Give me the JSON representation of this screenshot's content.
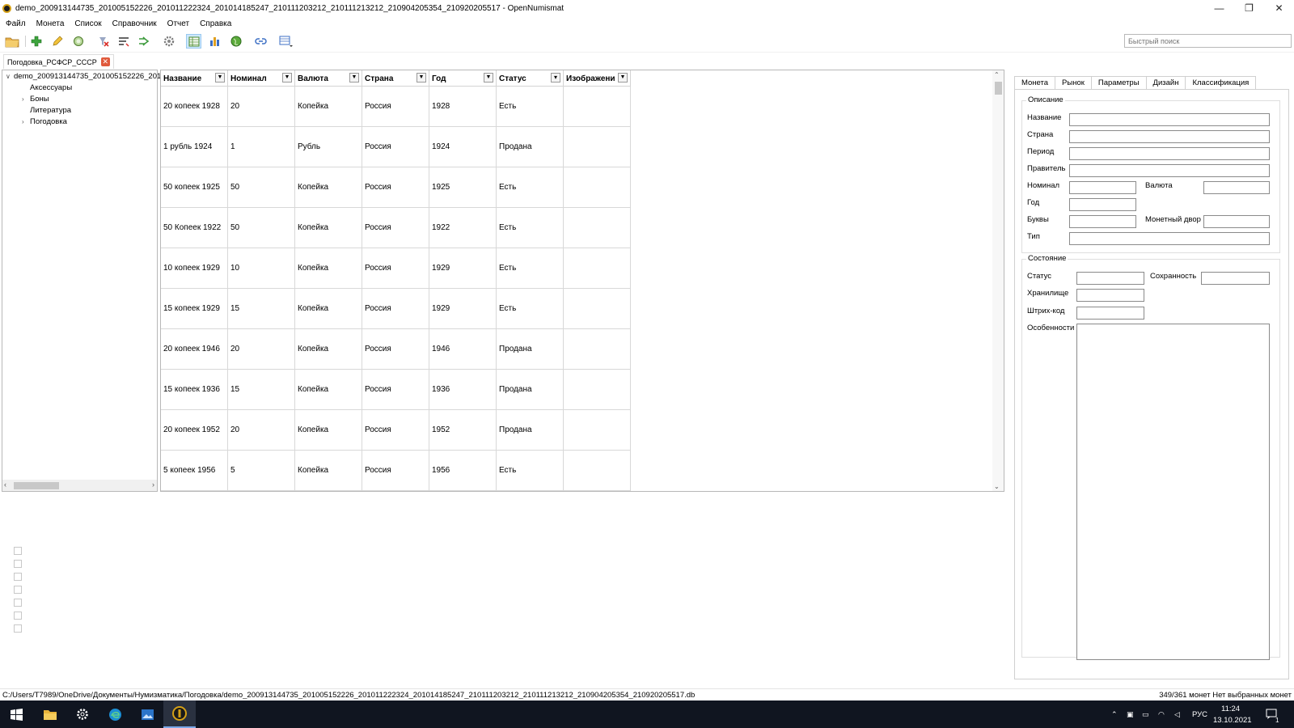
{
  "window": {
    "title": "demo_200913144735_201005152226_201011222324_201014185247_210111203212_210111213212_210904205354_210920205517 - OpenNumismat",
    "minimize": "—",
    "restore": "❐",
    "close": "✕"
  },
  "menu": [
    "Файл",
    "Монета",
    "Список",
    "Справочник",
    "Отчет",
    "Справка"
  ],
  "toolbar": {
    "icons": [
      "open-folder-icon",
      "add-icon",
      "edit-icon",
      "clone-icon",
      "delete-icon",
      "sort-icon",
      "merge-icon",
      "settings-gear-icon",
      "list-view-icon",
      "statistics-icon",
      "globe-icon",
      "link-icon",
      "table-settings-icon"
    ],
    "search_placeholder": "Быстрый поиск"
  },
  "doc_tab": {
    "label": "Погодовка_РСФСР_СССР",
    "close": "✕"
  },
  "tree": {
    "root": "demo_200913144735_201005152226_201",
    "items": [
      {
        "label": "Аксессуары",
        "expandable": false
      },
      {
        "label": "Боны",
        "expandable": true
      },
      {
        "label": "Литература",
        "expandable": false
      },
      {
        "label": "Погодовка",
        "expandable": true
      }
    ]
  },
  "table": {
    "columns": [
      "Название",
      "Номинал",
      "Валюта",
      "Страна",
      "Год",
      "Статус",
      "Изображени"
    ],
    "filtered_column": "Статус",
    "rows": [
      [
        "20 копеек 1928",
        "20",
        "Копейка",
        "Россия",
        "1928",
        "Есть",
        ""
      ],
      [
        "1 рубль 1924",
        "1",
        "Рубль",
        "Россия",
        "1924",
        "Продана",
        ""
      ],
      [
        "50 копеек 1925",
        "50",
        "Копейка",
        "Россия",
        "1925",
        "Есть",
        ""
      ],
      [
        "50 Копеек 1922",
        "50",
        "Копейка",
        "Россия",
        "1922",
        "Есть",
        ""
      ],
      [
        "10 копеек 1929",
        "10",
        "Копейка",
        "Россия",
        "1929",
        "Есть",
        ""
      ],
      [
        "15 копеек 1929",
        "15",
        "Копейка",
        "Россия",
        "1929",
        "Есть",
        ""
      ],
      [
        "20 копеек 1946",
        "20",
        "Копейка",
        "Россия",
        "1946",
        "Продана",
        ""
      ],
      [
        "15 копеек 1936",
        "15",
        "Копейка",
        "Россия",
        "1936",
        "Продана",
        ""
      ],
      [
        "20 копеек 1952",
        "20",
        "Копейка",
        "Россия",
        "1952",
        "Продана",
        ""
      ],
      [
        "5 копеек 1956",
        "5",
        "Копейка",
        "Россия",
        "1956",
        "Есть",
        ""
      ]
    ]
  },
  "details": {
    "tabs": [
      "Монета",
      "Рынок",
      "Параметры",
      "Дизайн",
      "Классификация"
    ],
    "description": {
      "title": "Описание",
      "name": "Название",
      "country": "Страна",
      "period": "Период",
      "ruler": "Правитель",
      "value": "Номинал",
      "currency": "Валюта",
      "year": "Год",
      "letters": "Буквы",
      "mint": "Монетный двор",
      "type": "Тип"
    },
    "state": {
      "title": "Состояние",
      "status": "Статус",
      "grade": "Сохранность",
      "storage": "Хранилище",
      "barcode": "Штрих-код",
      "features": "Особенности"
    }
  },
  "statusbar": {
    "path": "C:/Users/T7989/OneDrive/Документы/Нумизматика/Погодовка/demo_200913144735_201005152226_201011222324_201014185247_210111203212_210111213212_210904205354_210920205517.db",
    "count": "349/361 монет  Нет выбранных монет"
  },
  "taskbar": {
    "apps": [
      "windows-start-icon",
      "file-explorer-icon",
      "settings-icon",
      "edge-icon",
      "photos-icon",
      "opennumismat-icon"
    ],
    "lang": "РУС",
    "time": "11:24",
    "date": "13.10.2021",
    "notifications": "1"
  }
}
